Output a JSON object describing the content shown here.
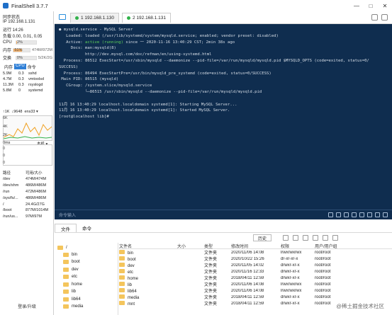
{
  "window": {
    "title": "FinalShell 3.7.7",
    "min": "—",
    "max": "□",
    "close": "✕"
  },
  "sidebar": {
    "sync_status": "同步状态",
    "ip": "IP 192.168.1.131",
    "uptime": "运行 14:26",
    "load": "负载 0.00, 0.01, 0.05",
    "cpu": {
      "label": "CPU",
      "percent": 2,
      "value_text": "2%",
      "extra": ""
    },
    "mem": {
      "label": "内存",
      "percent": 51,
      "value_text": "51%",
      "extra": "474M/972M"
    },
    "swap": {
      "label": "交换",
      "percent": 0,
      "value_text": "0%",
      "extra": "5/2K/2G"
    },
    "proc_tabs": [
      "内存",
      "CPU",
      "命令"
    ],
    "processes": [
      [
        "5.9M",
        "0.3",
        "sshd"
      ],
      [
        "4.7M",
        "0.3",
        "vmtoolsd"
      ],
      [
        "11.3M",
        "0.3",
        "rsyslogd"
      ],
      [
        "5.8M",
        "0",
        "systemd"
      ]
    ],
    "net": {
      "up": "↑1K",
      "down": "↓9648",
      "iface": "ens33 ▾"
    },
    "net_scale": [
      "6K",
      "4K",
      "2K"
    ],
    "ping": {
      "latency": "0ms",
      "host": "本机 ▾"
    },
    "ping_scale": [
      "0",
      "0",
      "0"
    ],
    "disk_headers": [
      "路径",
      "可用/大小"
    ],
    "disks": [
      [
        "/dev",
        "474M/474M"
      ],
      [
        "/dev/shm",
        "486M/486M"
      ],
      [
        "/run",
        "472M/486M"
      ],
      [
        "/sys/fs/...",
        "486M/486M"
      ],
      [
        "/",
        "24.4G/27G"
      ],
      [
        "/boot",
        "877M/1014M"
      ],
      [
        "/run/us...",
        "97M/97M"
      ]
    ],
    "bottom": "登录/升级"
  },
  "tabs": [
    {
      "label": "1 192.168.1.130",
      "active": false
    },
    {
      "label": "2 192.168.1.131",
      "active": true
    }
  ],
  "terminal": {
    "lines": [
      "● mysqld.service - MySQL Server",
      "   Loaded: loaded (/usr/lib/systemd/system/mysqld.service; enabled; vendor preset: disabled)",
      "   Active: active (running) since 一 2020-11-16 13:40:29 CST; 2min 38s ago",
      "     Docs: man:mysqld(8)",
      "           http://dev.mysql.com/doc/refman/en/using-systemd.html",
      "  Process: 86512 ExecStart=/usr/sbin/mysqld --daemonize --pid-file=/var/run/mysqld/mysqld.pid $MYSQLD_OPTS (code=exited, status=0/",
      "SUCCESS)",
      "  Process: 86494 ExecStartPre=/usr/bin/mysqld_pre_systemd (code=exited, status=0/SUCCESS)",
      " Main PID: 86515 (mysqld)",
      "   CGroup: /system.slice/mysqld.service",
      "           └─86515 /usr/sbin/mysqld --daemonize --pid-file=/var/run/mysqld/mysqld.pid",
      "",
      "11月 16 13:40:29 localhost.localdomain systemd[1]: Starting MySQL Server...",
      "11月 16 13:40:29 localhost.localdomain systemd[1]: Started MySQL Server.",
      "[root@localhost lib]# "
    ],
    "cmd_hint": "命令输入"
  },
  "filemanager": {
    "tabs": [
      "文件",
      "命令"
    ],
    "history_label": "历史",
    "tree_root": "/",
    "tree": [
      "bin",
      "boot",
      "dev",
      "etc",
      "home",
      "lib",
      "lib64",
      "media"
    ],
    "headers": [
      "文件名",
      "大小",
      "类型",
      "修改时间",
      "权限",
      "用户/用户组"
    ],
    "files": [
      [
        "bin",
        "",
        "文件夹",
        "2020/11/06 14:08",
        "lrwxrwxrwx",
        "root/root"
      ],
      [
        "boot",
        "",
        "文件夹",
        "2020/10/22 15:26",
        "dr-xr-xr-x",
        "root/root"
      ],
      [
        "dev",
        "",
        "文件夹",
        "2020/11/05 14:02",
        "drwxr-xr-x",
        "root/root"
      ],
      [
        "etc",
        "",
        "文件夹",
        "2020/11/16 12:33",
        "drwxr-xr-x",
        "root/root"
      ],
      [
        "home",
        "",
        "文件夹",
        "2018/04/11 12:59",
        "drwxr-xr-x",
        "root/root"
      ],
      [
        "lib",
        "",
        "文件夹",
        "2020/11/06 14:08",
        "lrwxrwxrwx",
        "root/root"
      ],
      [
        "lib64",
        "",
        "文件夹",
        "2020/11/06 14:08",
        "lrwxrwxrwx",
        "root/root"
      ],
      [
        "media",
        "",
        "文件夹",
        "2018/04/11 12:59",
        "drwxr-xr-x",
        "root/root"
      ],
      [
        "mnt",
        "",
        "文件夹",
        "2018/04/11 12:59",
        "drwxr-xr-x",
        "root/root"
      ]
    ]
  },
  "watermark": "@稀土掘金技术社区"
}
